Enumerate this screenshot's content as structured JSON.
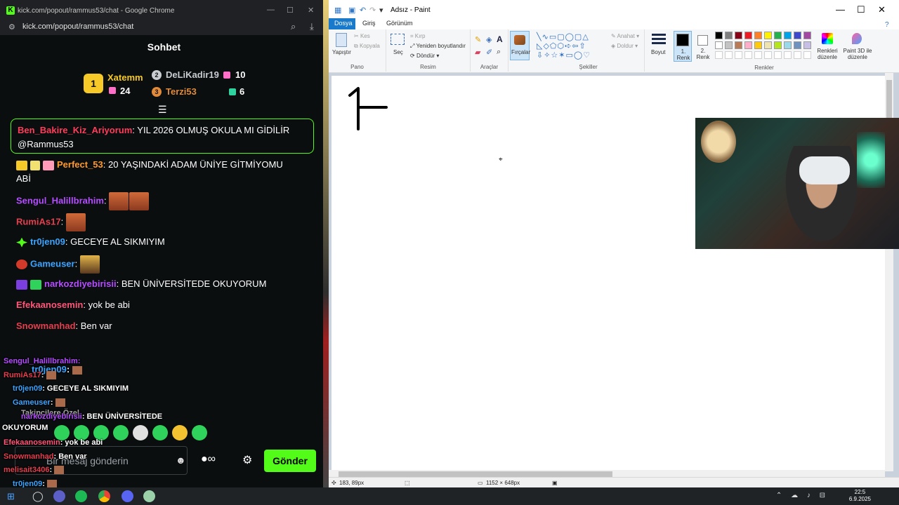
{
  "chrome": {
    "title": "kick.com/popout/rammus53/chat - Google Chrome",
    "url": "kick.com/popout/rammus53/chat"
  },
  "chat": {
    "header": "Sohbet",
    "leaderboard": {
      "first": {
        "rank": "1",
        "name": "Xatemm",
        "count": "24"
      },
      "second": {
        "rank": "2",
        "name": "DeLiKadir19",
        "count": "10"
      },
      "third": {
        "rank": "3",
        "name": "Terzi53",
        "count": "6"
      }
    },
    "pinned": {
      "user": "Ben_Bakire_Kiz_Ariyorum",
      "text": ": YIL 2026 OLMUŞ OKULA MI GİDİLİR",
      "text2": "@Rammus53"
    },
    "messages": [
      {
        "user": "Perfect_53",
        "text": ": 20 YAŞINDAKİ ADAM ÜNİYE GİTMİYOMU",
        "text2": "ABİ",
        "color": "#ff9a2e"
      },
      {
        "user": "Sengul_Halillbrahim",
        "text": ":",
        "color": "#b44cff"
      },
      {
        "user": "RumiAs17",
        "text": ":",
        "color": "#e33f4e"
      },
      {
        "user": "tr0jen09",
        "text": ": GECEYE AL SIKMIYIM",
        "color": "#3ba4ff"
      },
      {
        "user": "Gameuser",
        "text": ":",
        "color": "#3ba4ff"
      },
      {
        "user": "narkozdiyebirisii",
        "text": ": BEN ÜNİVERSİTEDE OKUYORUM",
        "color": "#b44cff"
      },
      {
        "user": "Efekaanosemin",
        "text": ": yok be abi",
        "color": "#ff5577"
      },
      {
        "user": "Snowmanhad",
        "text": ": Ben var",
        "color": "#e33f4e"
      }
    ],
    "overlay": [
      {
        "user": "Sengul_Halillbrahim",
        "text": ":"
      },
      {
        "user": "tr0jen09",
        "text": ":"
      },
      {
        "user": "RumiAs17",
        "text": ":"
      },
      {
        "user": "tr0jen09",
        "text": ": GECEYE AL SIKMIYIM"
      },
      {
        "user": "Gameuser",
        "text": ":"
      },
      {
        "user": "narkozdiyebirisii",
        "text": ": BEN ÜNİVERSİTEDE"
      },
      {
        "user": "",
        "text": "OKUYORUM"
      },
      {
        "user": "Efekaanosemin",
        "text": ": yok be abi"
      },
      {
        "user": "Snowmanhad",
        "text": ": Ben var"
      },
      {
        "user": "melisait3406",
        "text": ":"
      },
      {
        "user": "tr0jen09",
        "text": ":"
      },
      {
        "user": "Takipçilere Özel",
        "text": ""
      }
    ],
    "input_placeholder": "Bir mesaj gönderin",
    "send_label": "Gönder"
  },
  "paint": {
    "title": "Adsız - Paint",
    "tabs": [
      "Dosya",
      "Giriş",
      "Görünüm"
    ],
    "ribbon": {
      "paste": "Yapıştır",
      "cut": "Kes",
      "copy": "Kopyala",
      "pano": "Pano",
      "select": "Seç",
      "crop": "Kırp",
      "resize": "Yeniden boyutlandır",
      "rotate": "Döndür",
      "resim": "Resim",
      "araclar": "Araçlar",
      "brushes": "Fırçalar",
      "outline": "Anahat",
      "fill": "Doldur",
      "sekiller": "Şekiller",
      "size": "Boyut",
      "color1": "1. Renk",
      "color2": "2. Renk",
      "edit_colors": "Renkleri düzenle",
      "paint3d": "Paint 3D ile düzenle",
      "renkler": "Renkler"
    },
    "palette_colors": [
      "#000000",
      "#7f7f7f",
      "#880015",
      "#ed1c24",
      "#ff7f27",
      "#fff200",
      "#22b14c",
      "#00a2e8",
      "#3f48cc",
      "#a349a4",
      "#ffffff",
      "#c3c3c3",
      "#b97a57",
      "#ffaec9",
      "#ffc90e",
      "#efe4b0",
      "#b5e61d",
      "#99d9ea",
      "#7092be",
      "#c8bfe7"
    ],
    "status": {
      "cursor": "183, 89px",
      "size": "1152 × 648px"
    }
  },
  "taskbar": {
    "time": "22:5",
    "date": "6.9.2025"
  }
}
